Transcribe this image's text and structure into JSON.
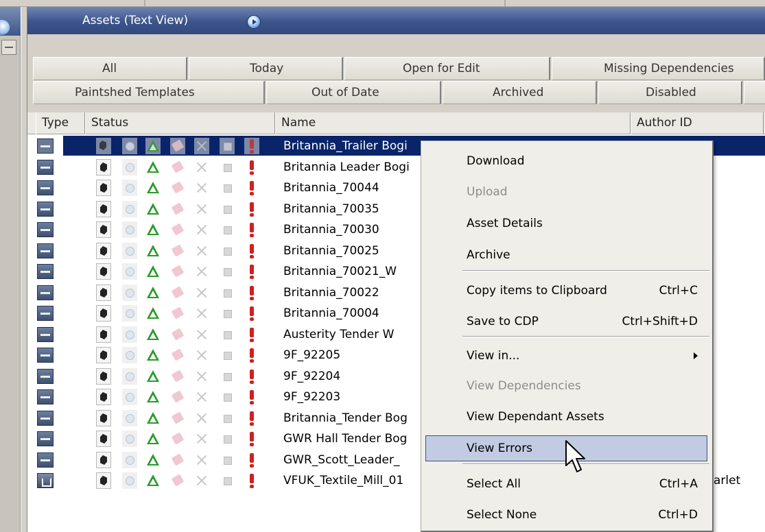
{
  "panel": {
    "title": "Assets (Text View)"
  },
  "tabs": {
    "row1": [
      "All",
      "Today",
      "Open for Edit",
      "Missing Dependencies"
    ],
    "row2": [
      "Paintshed Templates",
      "Out of Date",
      "Archived",
      "Disabled"
    ]
  },
  "columns": [
    "Type",
    "Status",
    "Name",
    "Author ID"
  ],
  "rows": [
    {
      "name": "Britannia_Trailer Bogi",
      "type": "train-icon",
      "selected": true
    },
    {
      "name": "Britannia Leader Bogi",
      "type": "train-icon"
    },
    {
      "name": "Britannia_70044",
      "type": "train-icon"
    },
    {
      "name": "Britannia_70035",
      "type": "train-icon"
    },
    {
      "name": "Britannia_70030",
      "type": "train-icon"
    },
    {
      "name": "Britannia_70025",
      "type": "train-icon"
    },
    {
      "name": "Britannia_70021_W",
      "type": "train-icon"
    },
    {
      "name": "Britannia_70022",
      "type": "train-icon"
    },
    {
      "name": "Britannia_70004",
      "type": "train-icon"
    },
    {
      "name": "Austerity Tender W",
      "type": "train-icon"
    },
    {
      "name": "9F_92205",
      "type": "train-icon"
    },
    {
      "name": "9F_92204",
      "type": "train-icon"
    },
    {
      "name": "9F_92203",
      "type": "train-icon"
    },
    {
      "name": "Britannia_Tender Bog",
      "type": "train-icon"
    },
    {
      "name": "GWR Hall Tender Bog",
      "type": "train-icon"
    },
    {
      "name": "GWR_Scott_Leader_",
      "type": "train-icon"
    },
    {
      "name": "VFUK_Textile_Mill_01",
      "type": "house-icon",
      "author": "arlet"
    }
  ],
  "context_menu": {
    "items": [
      {
        "label": "Download",
        "shortcut": "",
        "disabled": false
      },
      {
        "label": "Upload",
        "shortcut": "",
        "disabled": true
      },
      {
        "label": "Asset Details",
        "shortcut": "",
        "disabled": false
      },
      {
        "label": "Archive",
        "shortcut": "",
        "disabled": false
      },
      {
        "label": "Copy items to Clipboard",
        "shortcut": "Ctrl+C",
        "disabled": false
      },
      {
        "label": "Save to CDP",
        "shortcut": "Ctrl+Shift+D",
        "disabled": false
      },
      {
        "label": "View in...",
        "shortcut": "",
        "disabled": false,
        "submenu": true
      },
      {
        "label": "View Dependencies",
        "shortcut": "",
        "disabled": true
      },
      {
        "label": "View Dependant Assets",
        "shortcut": "",
        "disabled": false
      },
      {
        "label": "View Errors",
        "shortcut": "",
        "disabled": false,
        "highlighted": true
      },
      {
        "label": "Select All",
        "shortcut": "Ctrl+A",
        "disabled": false
      },
      {
        "label": "Select None",
        "shortcut": "Ctrl+D",
        "disabled": false
      }
    ]
  },
  "colors": {
    "titlebar": "#3b548a",
    "selection": "#0a246a",
    "menu_highlight": "#c1cbe2"
  }
}
